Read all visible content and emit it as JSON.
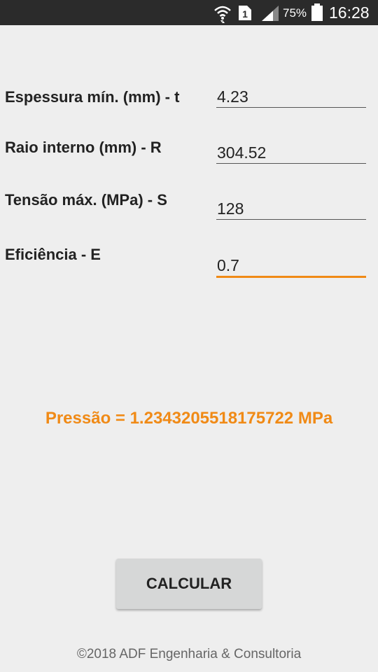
{
  "status_bar": {
    "battery_percent": "75%",
    "time": "16:28",
    "sim_slot": "1",
    "icons": [
      "wifi-icon",
      "sim-icon",
      "signal-icon",
      "battery-icon"
    ]
  },
  "form": {
    "fields": [
      {
        "label": "Espessura mín. (mm) - t",
        "value": "4.23"
      },
      {
        "label": "Raio interno (mm) - R",
        "value": "304.52"
      },
      {
        "label": "Tensão máx. (MPa) - S",
        "value": "128"
      },
      {
        "label": "Eficiência - E",
        "value": "0.7"
      }
    ]
  },
  "result": {
    "text": "Pressão = 1.2343205518175722 MPa"
  },
  "actions": {
    "calculate_label": "CALCULAR"
  },
  "footer": {
    "text": "©2018 ADF Engenharia & Consultoria"
  },
  "colors": {
    "accent": "#f08a16",
    "status_bar": "#2b2b2b",
    "background": "#eeeeee"
  }
}
